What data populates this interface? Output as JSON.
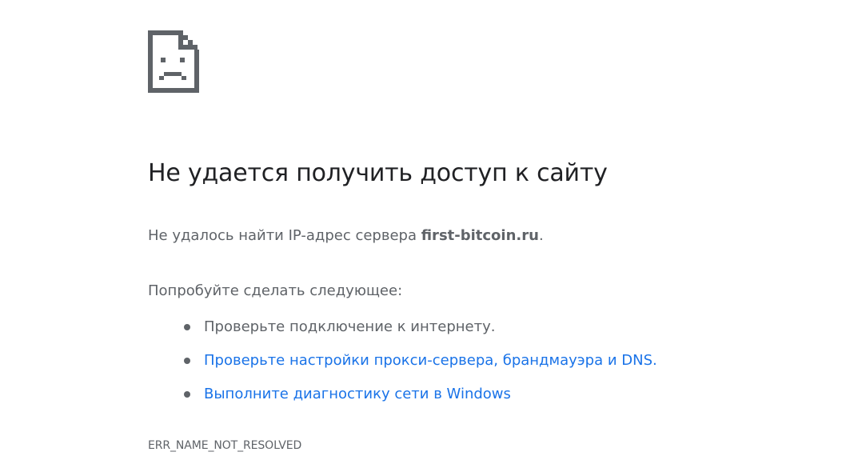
{
  "icon": {
    "name": "sad-page-icon",
    "color": "#5f6368"
  },
  "title": "Не удается получить доступ к сайту",
  "summary": {
    "prefix": "Не удалось найти IP-адрес сервера ",
    "host": "first-bitcoin.ru",
    "suffix": "."
  },
  "suggestions": {
    "heading": "Попробуйте сделать следующее:",
    "items": [
      {
        "text": "Проверьте подключение к интернету.",
        "link": false
      },
      {
        "text": "Проверьте настройки прокси-сервера, брандмауэра и DNS.",
        "link": true
      },
      {
        "text": "Выполните диагностику сети в Windows",
        "link": true
      }
    ]
  },
  "error_code": "ERR_NAME_NOT_RESOLVED",
  "colors": {
    "title": "#202124",
    "body_text": "#5f6368",
    "link": "#1a73e8",
    "background": "#ffffff"
  }
}
